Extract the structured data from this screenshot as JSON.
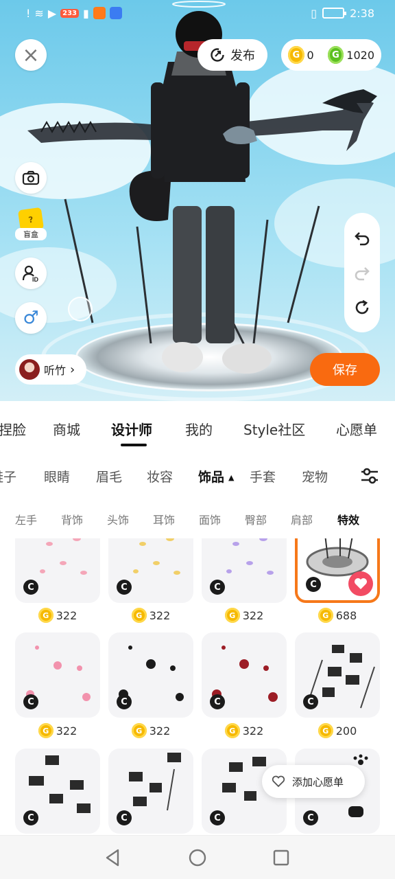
{
  "status_bar": {
    "time": "2:38",
    "badge": "233"
  },
  "top": {
    "close_label": "×",
    "publish_label": "发布",
    "gold_amount": "0",
    "green_amount": "1020",
    "coin_glyph": "G"
  },
  "left_tools": {
    "blind_box_label": "盲盒",
    "blind_box_mark": "?",
    "id_glyph": "ID",
    "gender_glyph": "♂"
  },
  "user": {
    "name": "听竹"
  },
  "save_label": "保存",
  "tabs": [
    "捏脸",
    "商城",
    "设计师",
    "我的",
    "Style社区",
    "心愿单"
  ],
  "subtabs": [
    "鞋子",
    "眼睛",
    "眉毛",
    "妆容",
    "饰品",
    "手套",
    "宠物"
  ],
  "active_subtab_arrow": "▲",
  "slots": [
    "左手",
    "背饰",
    "头饰",
    "耳饰",
    "面饰",
    "臀部",
    "肩部",
    "特效"
  ],
  "items": [
    {
      "price": "322",
      "mark": "C"
    },
    {
      "price": "322",
      "mark": "C"
    },
    {
      "price": "322",
      "mark": "C"
    },
    {
      "price": "688",
      "mark": "C"
    },
    {
      "price": "322",
      "mark": "C"
    },
    {
      "price": "322",
      "mark": "C"
    },
    {
      "price": "322",
      "mark": "C"
    },
    {
      "price": "200",
      "mark": "C"
    },
    {
      "price": "",
      "mark": "C"
    },
    {
      "price": "",
      "mark": "C"
    },
    {
      "price": "",
      "mark": "C"
    },
    {
      "price": "",
      "mark": "C"
    }
  ],
  "wishlist_pill": "添加心愿单",
  "colors": {
    "accent": "#f96a10",
    "selected_border": "#f6781a",
    "fav": "#f24b63",
    "gold": "#f6b900",
    "green": "#5cc020"
  }
}
